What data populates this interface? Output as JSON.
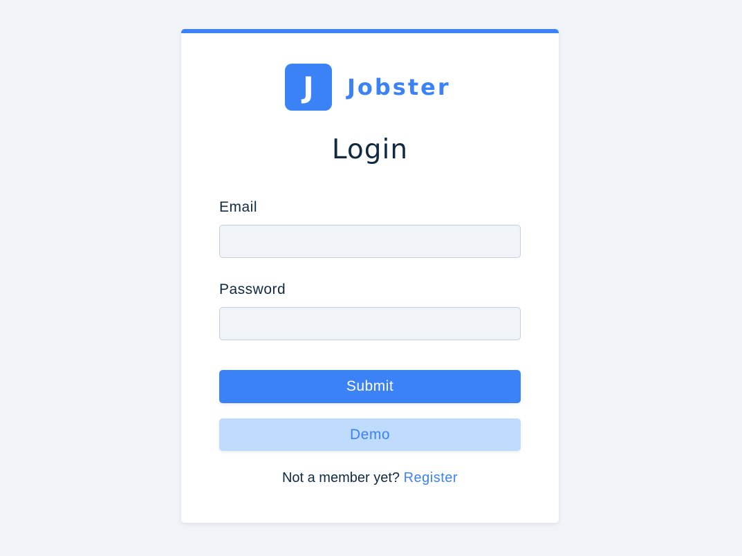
{
  "brand": {
    "logo_letter": "J",
    "name": "Jobster",
    "accent_color": "#3b82f6"
  },
  "form": {
    "title": "Login",
    "email_label": "Email",
    "email_value": "",
    "password_label": "Password",
    "password_value": "",
    "submit_label": "Submit",
    "demo_label": "Demo"
  },
  "footer": {
    "prompt_text": "Not a member yet?",
    "register_link": "Register"
  }
}
